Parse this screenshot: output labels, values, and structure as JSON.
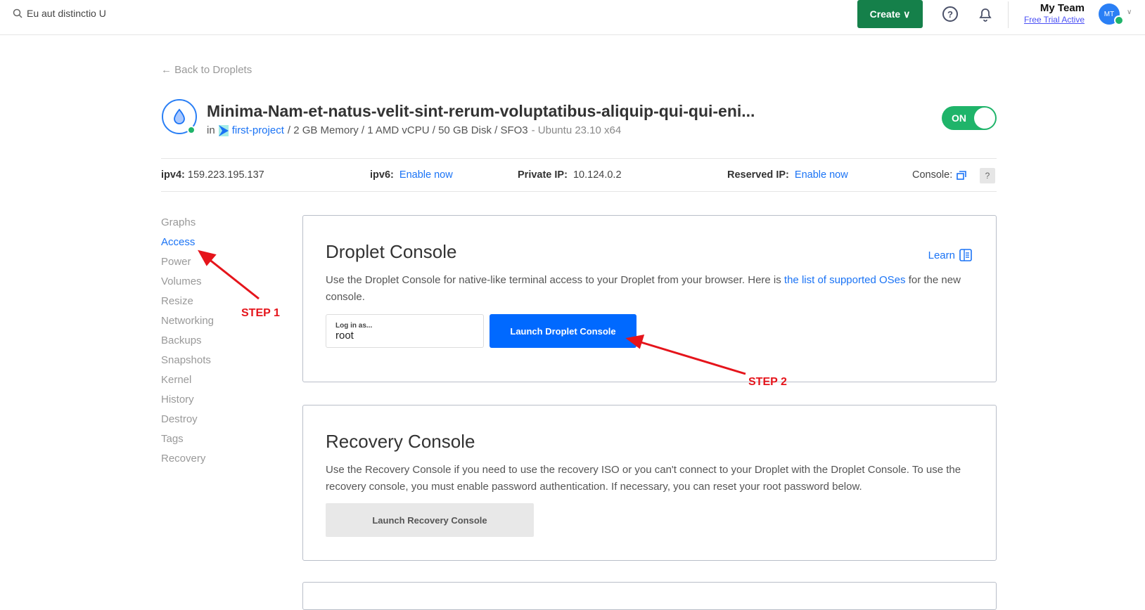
{
  "topbar": {
    "search_value": "Eu aut distinctio U",
    "create_label": "Create",
    "team_name": "My Team",
    "trial": "Free Trial Active",
    "avatar": "MT"
  },
  "back": "Back to Droplets",
  "droplet": {
    "name": "Minima-Nam-et-natus-velit-sint-rerum-voluptatibus-aliquip-qui-qui-eni...",
    "in": "in",
    "project": "first-project",
    "specs": "/ 2 GB Memory / 1 AMD vCPU / 50 GB Disk / SFO3",
    "os": "- Ubuntu 23.10 x64",
    "power": "ON"
  },
  "ips": {
    "ipv4_label": "ipv4:",
    "ipv4": "159.223.195.137",
    "ipv6_label": "ipv6:",
    "ipv6": "Enable now",
    "private_label": "Private IP:",
    "private": "10.124.0.2",
    "reserved_label": "Reserved IP:",
    "reserved": "Enable now",
    "console": "Console:",
    "help": "?"
  },
  "nav": [
    "Graphs",
    "Access",
    "Power",
    "Volumes",
    "Resize",
    "Networking",
    "Backups",
    "Snapshots",
    "Kernel",
    "History",
    "Destroy",
    "Tags",
    "Recovery"
  ],
  "droplet_console": {
    "title": "Droplet Console",
    "learn": "Learn",
    "desc_pre": "Use the Droplet Console for native-like terminal access to your Droplet from your browser. Here is ",
    "link": "the list of supported OSes",
    "desc_post": " for the new console.",
    "login_label": "Log in as...",
    "login_value": "root",
    "button": "Launch Droplet Console"
  },
  "recovery_console": {
    "title": "Recovery Console",
    "desc": "Use the Recovery Console if you need to use the recovery ISO or you can't connect to your Droplet with the Droplet Console. To use the recovery console, you must enable password authentication. If necessary, you can reset your root password below.",
    "button": "Launch Recovery Console"
  },
  "annotations": {
    "step1": "STEP 1",
    "step2": "STEP 2"
  },
  "colors": {
    "primary": "#0069ff",
    "create": "#15804a",
    "on": "#1fb46a",
    "annotation": "#e5141b"
  }
}
